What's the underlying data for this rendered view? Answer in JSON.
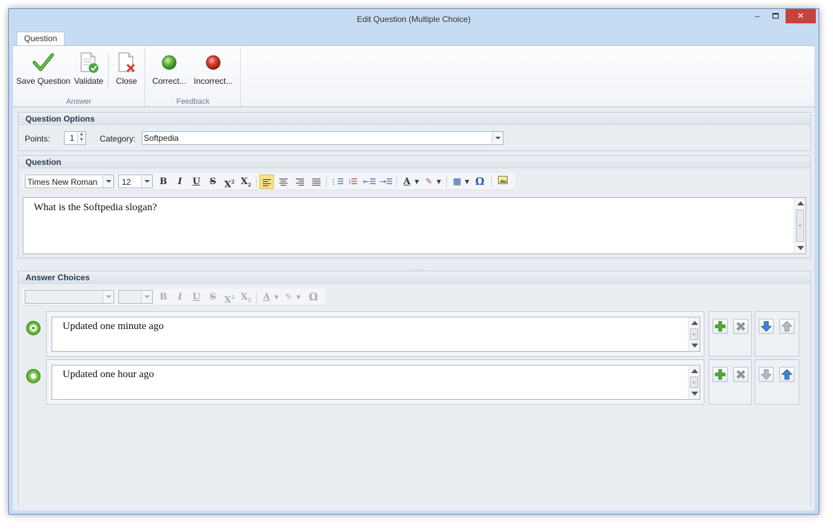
{
  "window": {
    "title": "Edit Question (Multiple Choice)",
    "minimize": "–",
    "close": "✕"
  },
  "ribbon": {
    "tab": "Question",
    "groups": [
      {
        "label": "Answer",
        "buttons": [
          "Save Question",
          "Validate",
          "Close"
        ]
      },
      {
        "label": "Feedback",
        "buttons": [
          "Correct...",
          "Incorrect..."
        ]
      }
    ]
  },
  "question_options": {
    "header": "Question Options",
    "points_label": "Points:",
    "points_value": "1",
    "category_label": "Category:",
    "category_value": "Softpedia"
  },
  "question": {
    "header": "Question",
    "font": "Times New Roman",
    "size": "12",
    "text": "What is the Softpedia slogan?"
  },
  "answers": {
    "header": "Answer Choices",
    "items": [
      {
        "text": "Updated one minute ago",
        "correct": true
      },
      {
        "text": "Updated one hour ago",
        "correct": false
      }
    ]
  },
  "icons": {
    "save": "check-icon",
    "validate": "validate-doc-icon",
    "close": "close-doc-icon",
    "correct": "green-circle-icon",
    "incorrect": "red-circle-icon",
    "add": "plus-icon",
    "delete": "x-icon",
    "down": "arrow-down-icon",
    "up": "arrow-up-icon"
  },
  "colors": {
    "accent_green": "#4f9a2a",
    "titlebar": "#c6dcf3",
    "close_button": "#c7443a"
  }
}
